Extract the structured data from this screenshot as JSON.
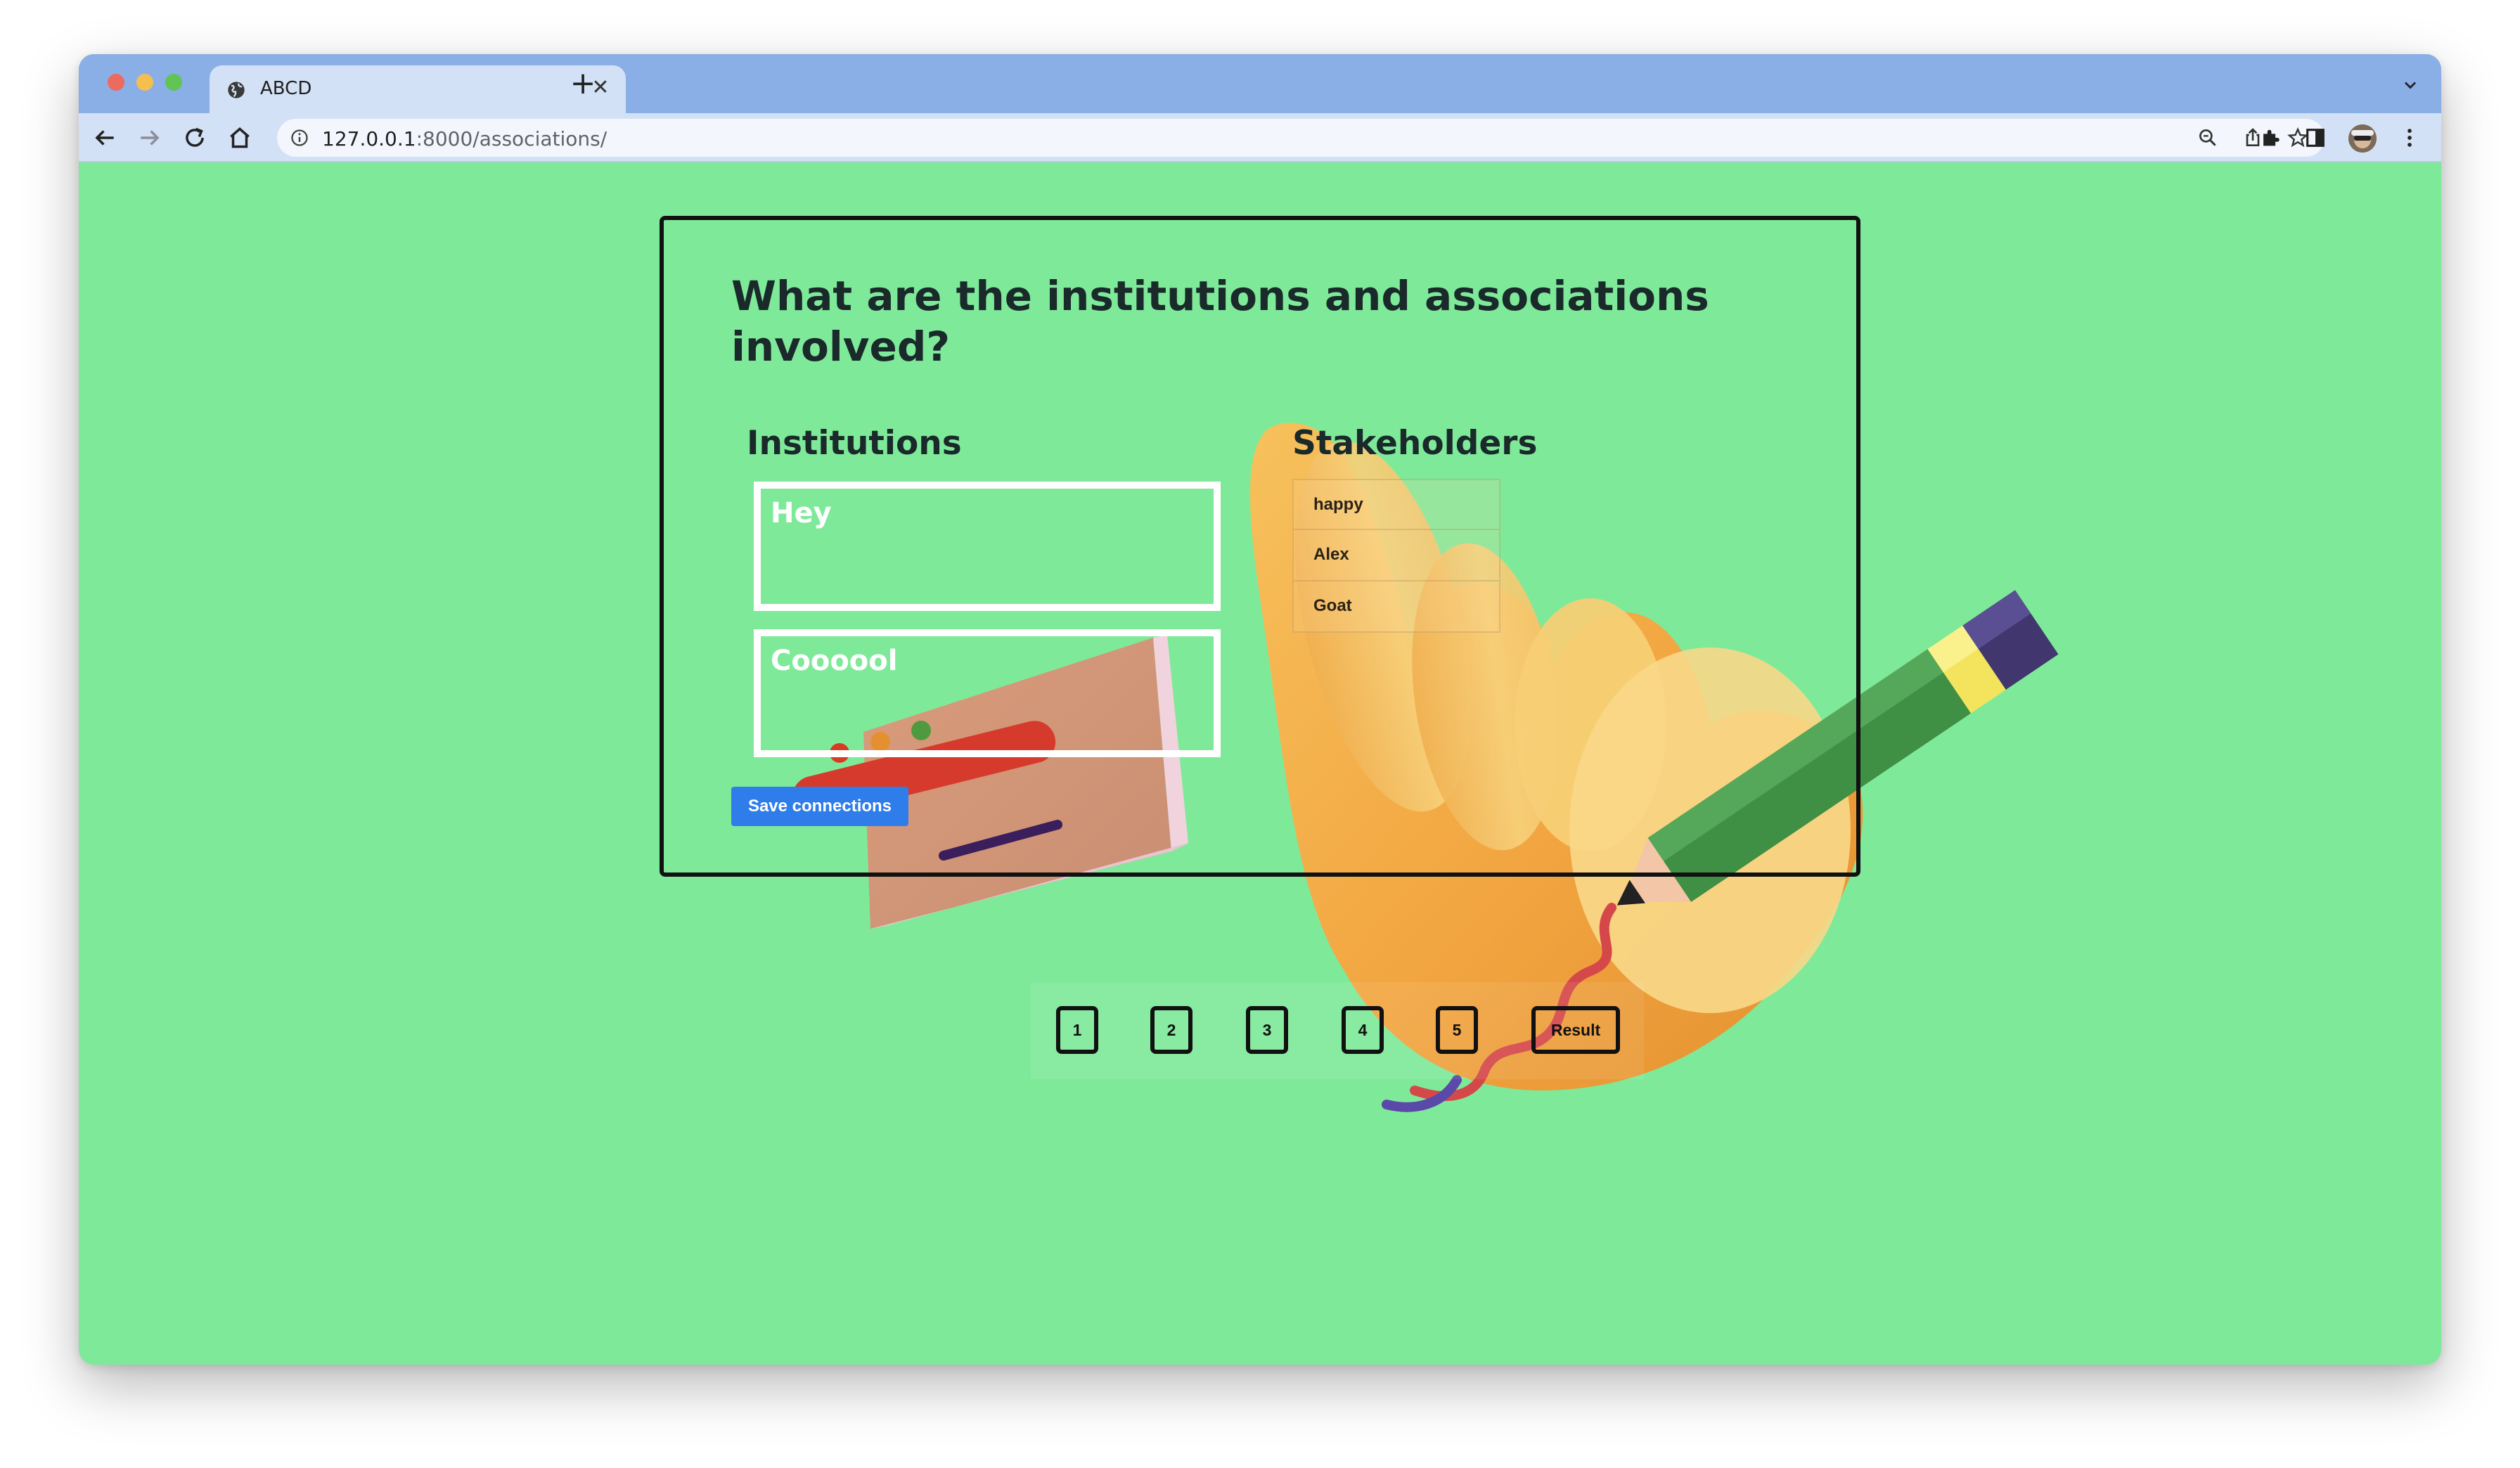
{
  "browser": {
    "tab_title": "ABCD",
    "url_host": "127.0.0.1",
    "url_rest": ":8000/associations/"
  },
  "page": {
    "question": "What are the institutions and associations involved?",
    "institutions_title": "Institutions",
    "stakeholders_title": "Stakeholders",
    "institutions": [
      "Hey",
      "Coooool"
    ],
    "stakeholders": [
      "happy",
      "Alex",
      "Goat"
    ],
    "save_label": "Save connections"
  },
  "pagination": {
    "pages": [
      "1",
      "2",
      "3",
      "4",
      "5"
    ],
    "result_label": "Result"
  },
  "colors": {
    "page_background": "#7fe99a",
    "tab_strip": "#8aaee6",
    "save_button": "#2f7dea"
  },
  "icons": [
    "globe-icon",
    "close-icon",
    "plus-icon",
    "chevron-down-icon",
    "back-arrow-icon",
    "forward-arrow-icon",
    "reload-icon",
    "home-icon",
    "info-icon",
    "zoom-icon",
    "share-icon",
    "star-icon",
    "extensions-icon",
    "sidebar-icon",
    "menu-dots-icon"
  ]
}
